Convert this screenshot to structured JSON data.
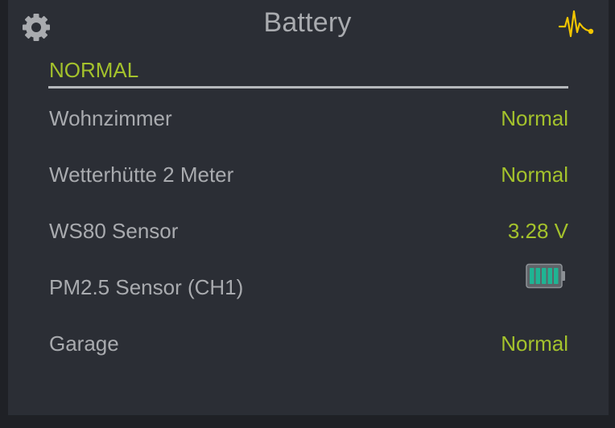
{
  "header": {
    "title": "Battery",
    "settings_icon": "gear-icon",
    "activity_icon": "pulse-icon"
  },
  "section": {
    "label": "NORMAL"
  },
  "rows": [
    {
      "label": "Wohnzimmer",
      "value": "Normal"
    },
    {
      "label": "Wetterhütte 2 Meter",
      "value": "Normal"
    },
    {
      "label": "WS80 Sensor",
      "value": "3.28 V"
    },
    {
      "label": "PM2.5 Sensor (CH1)",
      "value_icon": "battery-full-icon",
      "battery_level": 1.0
    },
    {
      "label": "Garage",
      "value": "Normal"
    }
  ],
  "colors": {
    "accent": "#a4c22c",
    "text": "#a9abaf",
    "panel_bg": "#2b2e35",
    "page_bg": "#1f2126",
    "pulse": "#f2c500",
    "battery_fill": "#1fb493"
  }
}
